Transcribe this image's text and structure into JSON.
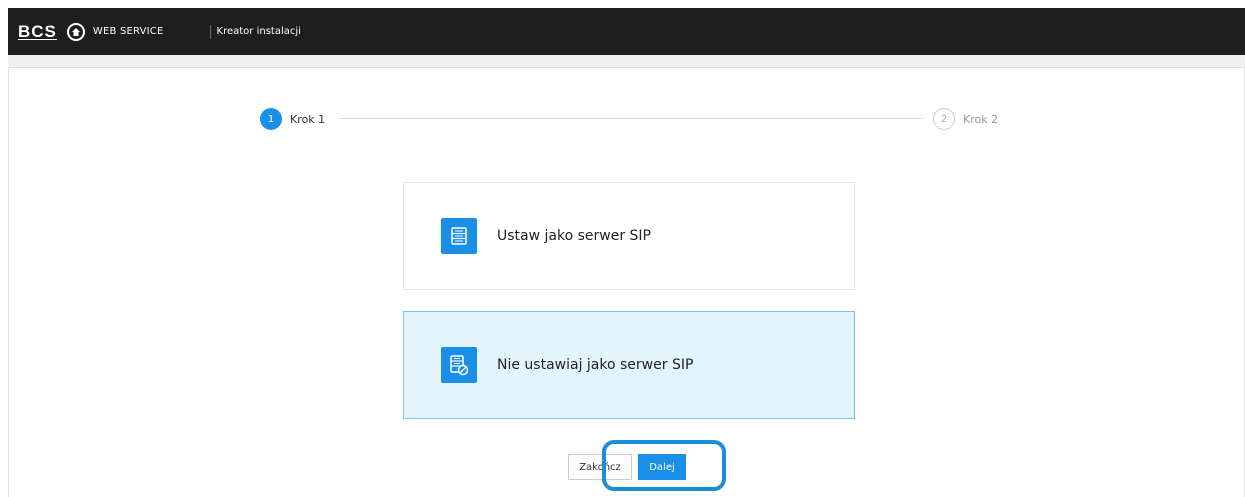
{
  "header": {
    "logo": "BCS",
    "service": "WEB SERVICE",
    "title": "Kreator instalacji"
  },
  "steps": [
    {
      "number": "1",
      "label": "Krok 1",
      "active": true
    },
    {
      "number": "2",
      "label": "Krok 2",
      "active": false
    }
  ],
  "options": [
    {
      "label": "Ustaw jako serwer SIP",
      "icon": "server-icon",
      "selected": false
    },
    {
      "label": "Nie ustawiaj jako serwer SIP",
      "icon": "server-disabled-icon",
      "selected": true
    }
  ],
  "buttons": {
    "finish": "Zakończ",
    "next": "Dalej"
  },
  "colors": {
    "accent": "#1a8fe8",
    "header_bg": "#1e1e1e",
    "selected_bg": "#e4f4fd",
    "highlight": "#1b8fd6"
  }
}
